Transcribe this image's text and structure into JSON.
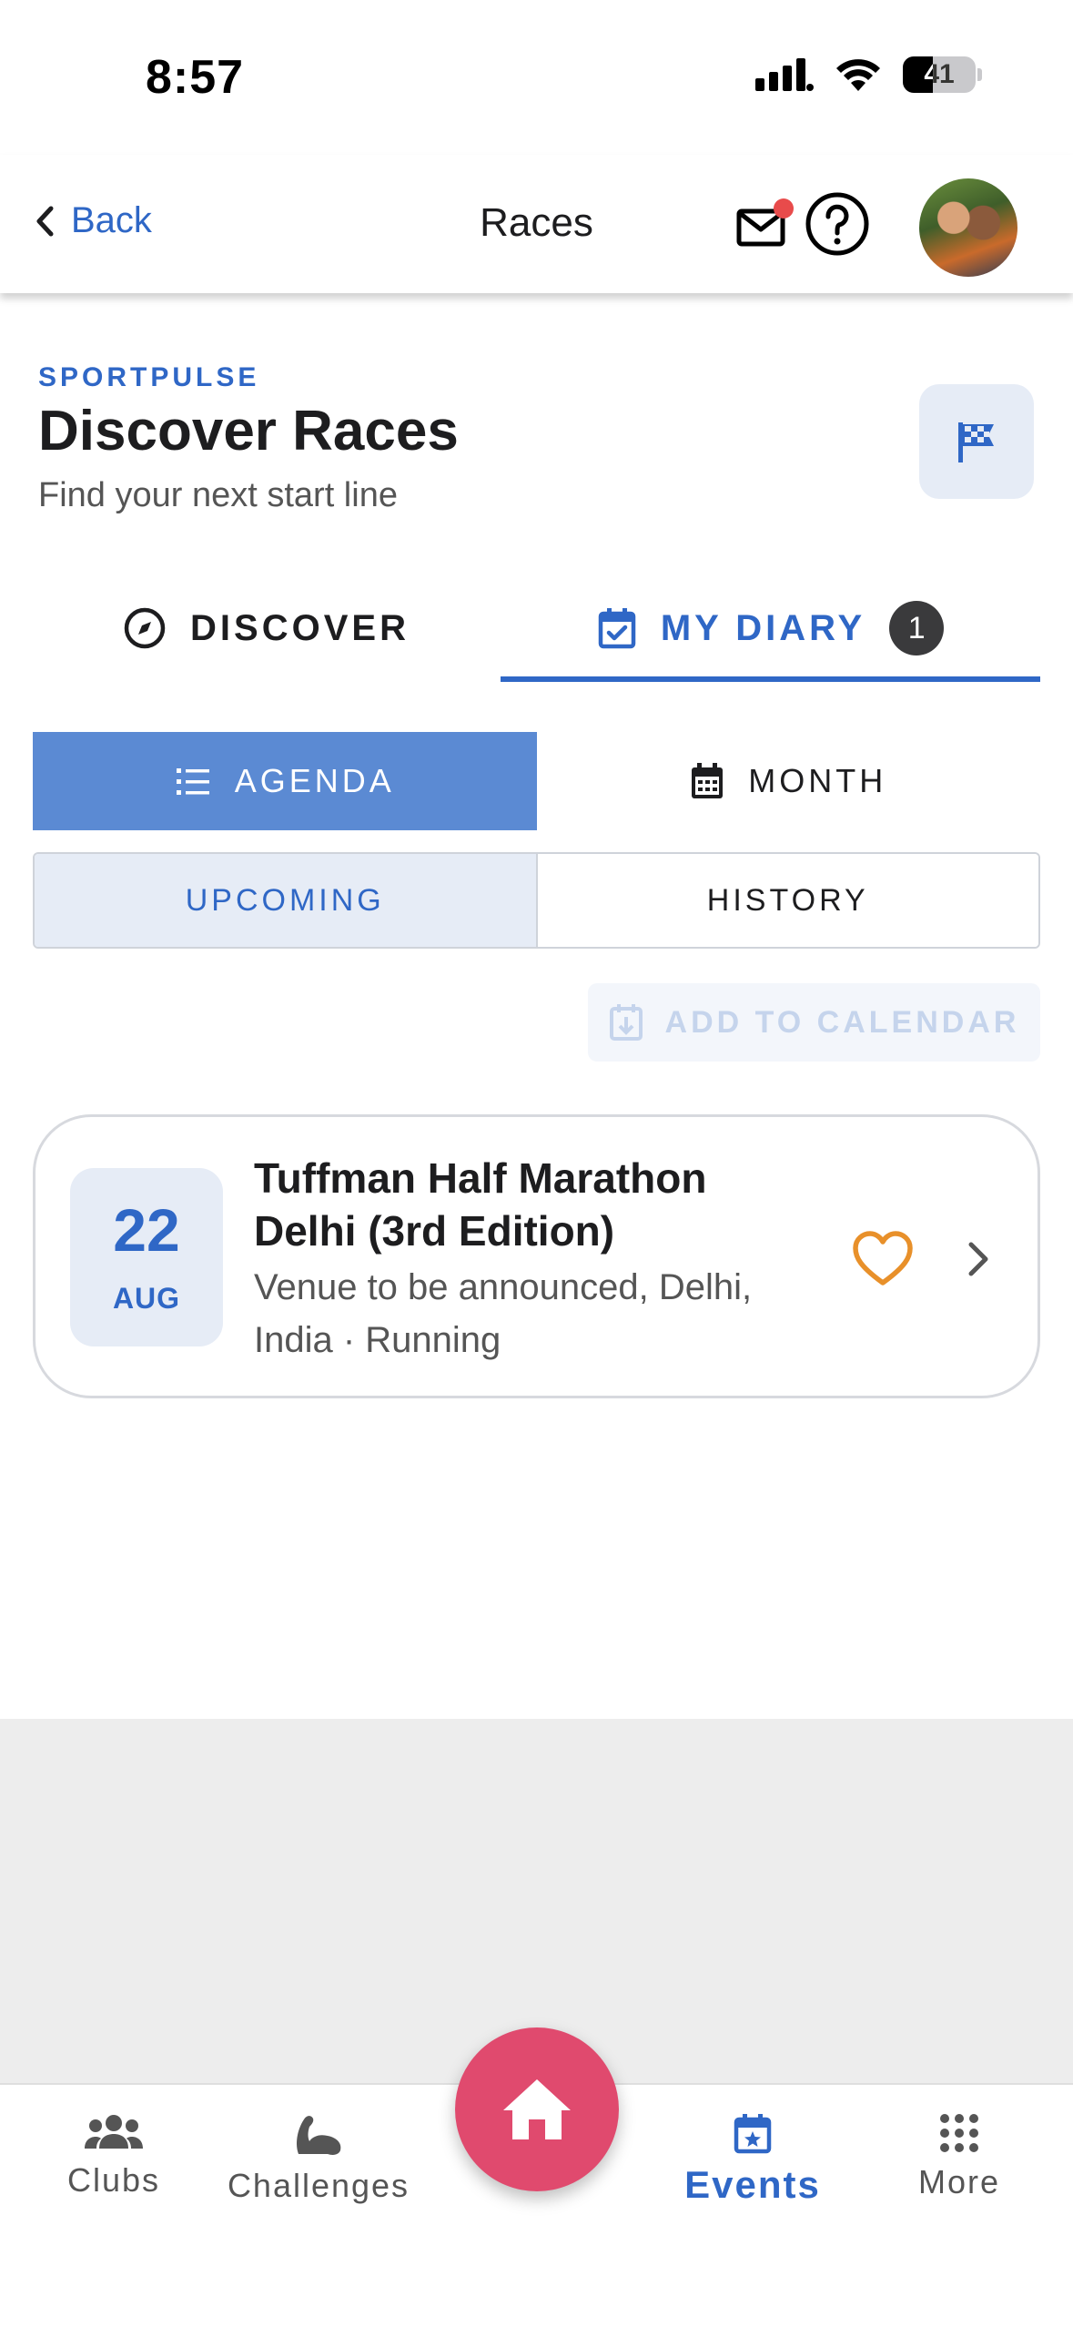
{
  "status_bar": {
    "time": "8:57",
    "battery": "41",
    "battery_level": 0.41
  },
  "header": {
    "back_label": "Back",
    "title": "Races"
  },
  "hero": {
    "brand": "SPORTPULSE",
    "title": "Discover Races",
    "subtitle": "Find your next start line"
  },
  "tabs": [
    {
      "label": "DISCOVER",
      "icon": "compass-icon",
      "active": false
    },
    {
      "label": "MY DIARY",
      "icon": "calendar-check-icon",
      "active": true,
      "badge": "1"
    }
  ],
  "view_toggle": [
    {
      "label": "AGENDA",
      "icon": "list-icon",
      "active": true
    },
    {
      "label": "MONTH",
      "icon": "calendar-icon",
      "active": false
    }
  ],
  "time_filter": [
    {
      "label": "UPCOMING",
      "active": true
    },
    {
      "label": "HISTORY",
      "active": false
    }
  ],
  "add_to_calendar": {
    "label": "ADD TO CALENDAR",
    "disabled": true
  },
  "events": [
    {
      "day": "22",
      "month": "AUG",
      "title": "Tuffman Half Marathon Delhi (3rd Edition)",
      "subtitle": "Venue to be announced, Delhi, India · Running"
    }
  ],
  "bottom_nav": {
    "items": [
      {
        "label": "Clubs",
        "icon": "people-icon"
      },
      {
        "label": "Challenges",
        "icon": "flexed-arm-icon"
      },
      {
        "label": "Events",
        "icon": "calendar-star-icon",
        "active": true
      },
      {
        "label": "More",
        "icon": "grid-icon"
      }
    ],
    "home_icon": "home-icon"
  },
  "colors": {
    "accent": "#2f67c6",
    "agenda_active": "#5b8ad3",
    "fab": "#e04a6e",
    "favorite": "#e8902a",
    "notification_dot": "#e84b4b"
  }
}
